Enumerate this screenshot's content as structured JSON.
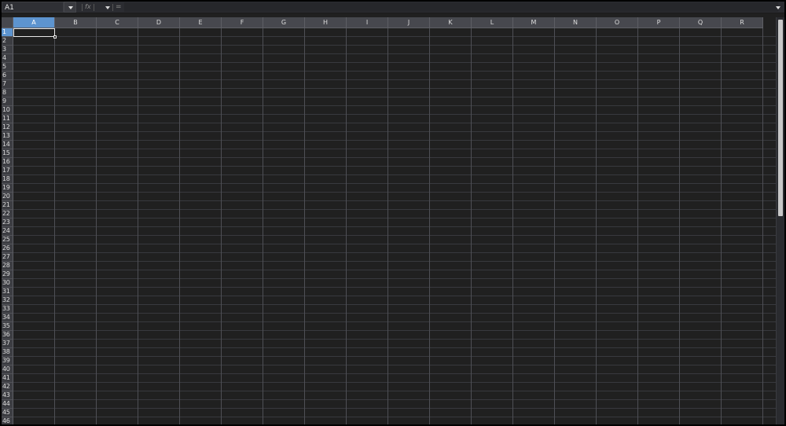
{
  "formula_bar": {
    "name_box_value": "A1",
    "fx_icon": "function-icon",
    "equals_icon": "equals-icon",
    "formula_value": "",
    "dropdown_icon": "chevron-down-icon"
  },
  "grid": {
    "columns": [
      "A",
      "B",
      "C",
      "D",
      "E",
      "F",
      "G",
      "H",
      "I",
      "J",
      "K",
      "L",
      "M",
      "N",
      "O",
      "P",
      "Q",
      "R"
    ],
    "rows": [
      "1",
      "2",
      "3",
      "4",
      "5",
      "6",
      "7",
      "8",
      "9",
      "10",
      "11",
      "12",
      "13",
      "14",
      "15",
      "16",
      "17",
      "18",
      "19",
      "20",
      "21",
      "22",
      "23",
      "24",
      "25",
      "26",
      "27",
      "28",
      "29",
      "30",
      "31",
      "32",
      "33",
      "34",
      "35",
      "36",
      "37",
      "38",
      "39",
      "40",
      "41",
      "42",
      "43",
      "44",
      "45",
      "46"
    ],
    "selected_cell": "A1",
    "selected_column": "A",
    "selected_row": "1"
  },
  "colors": {
    "background": "#202020",
    "header": "#47484e",
    "selection": "#5d94cf",
    "gridline": "#4e4f55"
  }
}
